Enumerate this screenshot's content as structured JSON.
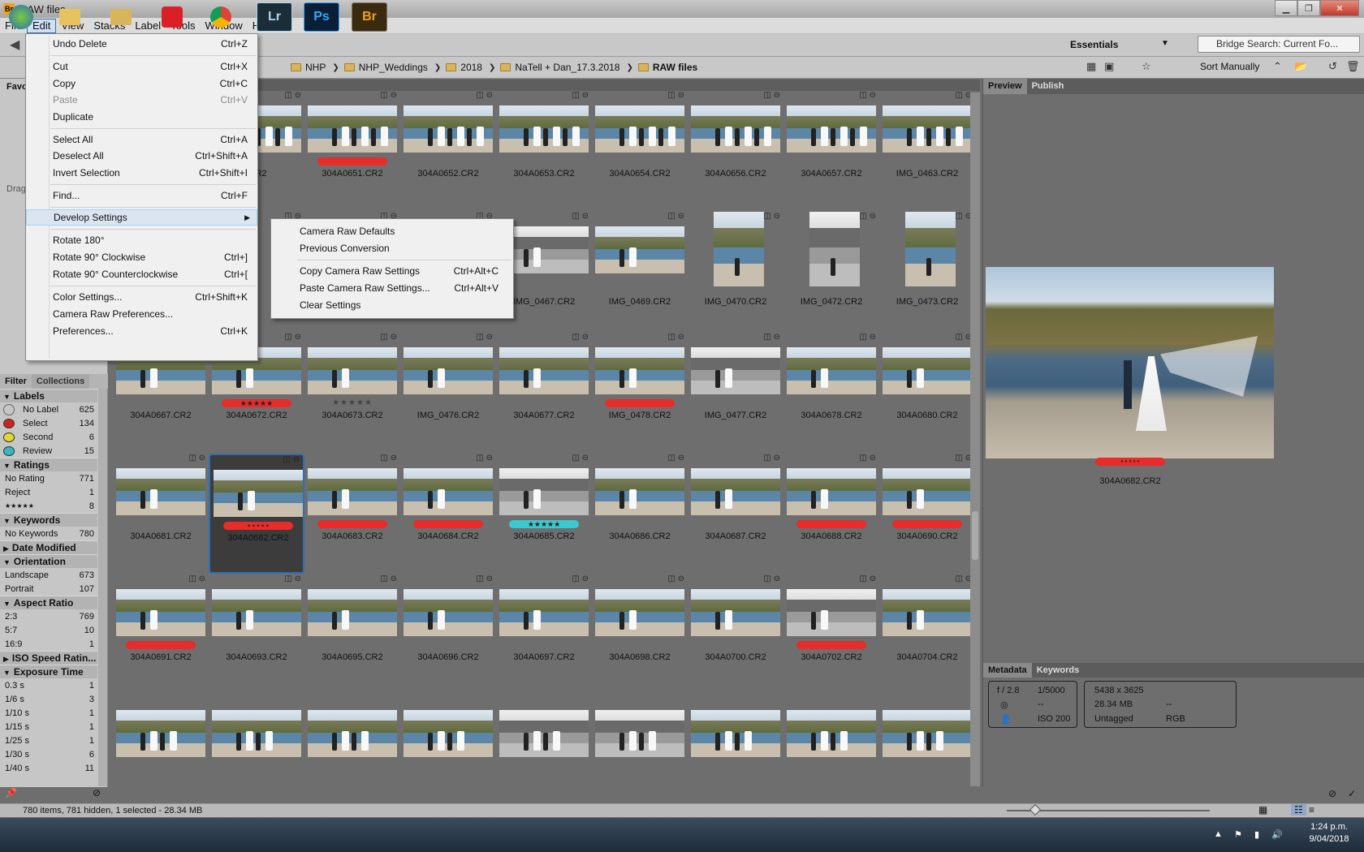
{
  "window": {
    "title": "RAW files"
  },
  "menubar": [
    "File",
    "Edit",
    "View",
    "Stacks",
    "Label",
    "Tools",
    "Window",
    "Help"
  ],
  "workspace": "Essentials",
  "search": {
    "placeholder": "Bridge Search: Current Fo..."
  },
  "breadcrumb": [
    "NHP",
    "NHP_Weddings",
    "2018",
    "NaTell + Dan_17.3.2018",
    "RAW files"
  ],
  "sort": "Sort Manually",
  "edit_menu": [
    {
      "label": "Undo Delete",
      "shortcut": "Ctrl+Z",
      "disabled": false
    },
    {
      "label": "Cut",
      "shortcut": "Ctrl+X",
      "disabled": false
    },
    {
      "label": "Copy",
      "shortcut": "Ctrl+C",
      "disabled": false
    },
    {
      "label": "Paste",
      "shortcut": "Ctrl+V",
      "disabled": true
    },
    {
      "label": "Duplicate",
      "shortcut": "",
      "disabled": false
    },
    {
      "label": "Select All",
      "shortcut": "Ctrl+A",
      "disabled": false
    },
    {
      "label": "Deselect All",
      "shortcut": "Ctrl+Shift+A",
      "disabled": false
    },
    {
      "label": "Invert Selection",
      "shortcut": "Ctrl+Shift+I",
      "disabled": false
    },
    {
      "label": "Find...",
      "shortcut": "Ctrl+F",
      "disabled": false
    },
    {
      "label": "Develop Settings",
      "shortcut": "",
      "disabled": false
    },
    {
      "label": "Rotate 180°",
      "shortcut": "",
      "disabled": false
    },
    {
      "label": "Rotate 90° Clockwise",
      "shortcut": "Ctrl+]",
      "disabled": false
    },
    {
      "label": "Rotate 90° Counterclockwise",
      "shortcut": "Ctrl+[",
      "disabled": false
    },
    {
      "label": "Color Settings...",
      "shortcut": "Ctrl+Shift+K",
      "disabled": false
    },
    {
      "label": "Camera Raw Preferences...",
      "shortcut": "",
      "disabled": false
    },
    {
      "label": "Preferences...",
      "shortcut": "Ctrl+K",
      "disabled": false
    }
  ],
  "develop_submenu": [
    {
      "label": "Camera Raw Defaults",
      "shortcut": ""
    },
    {
      "label": "Previous Conversion",
      "shortcut": ""
    },
    {
      "label": "Copy Camera Raw Settings",
      "shortcut": "Ctrl+Alt+C"
    },
    {
      "label": "Paste Camera Raw Settings...",
      "shortcut": "Ctrl+Alt+V"
    },
    {
      "label": "Clear Settings",
      "shortcut": ""
    }
  ],
  "left_panel": {
    "favorites_label": "Favo",
    "drag_label": "Drag",
    "tabs": [
      "Filter",
      "Collections"
    ],
    "sections": [
      {
        "title": "Labels",
        "rows": [
          [
            "No Label",
            "625"
          ],
          [
            "Select",
            "134"
          ],
          [
            "Second",
            "6"
          ],
          [
            "Review",
            "15"
          ]
        ]
      },
      {
        "title": "Ratings",
        "rows": [
          [
            "No Rating",
            "771"
          ],
          [
            "Reject",
            "1"
          ],
          [
            "★★★★★",
            "8"
          ]
        ]
      },
      {
        "title": "Keywords",
        "rows": [
          [
            "No Keywords",
            "780"
          ]
        ]
      },
      {
        "title": "Date Modified",
        "rows": []
      },
      {
        "title": "Orientation",
        "rows": [
          [
            "Landscape",
            "673"
          ],
          [
            "Portrait",
            "107"
          ]
        ]
      },
      {
        "title": "Aspect Ratio",
        "rows": [
          [
            "2:3",
            "769"
          ],
          [
            "5:7",
            "10"
          ],
          [
            "16:9",
            "1"
          ]
        ]
      },
      {
        "title": "ISO Speed Ratin...",
        "rows": []
      },
      {
        "title": "Exposure Time",
        "rows": [
          [
            "0.3 s",
            "1"
          ],
          [
            "1/6 s",
            "3"
          ],
          [
            "1/10 s",
            "1"
          ],
          [
            "1/15 s",
            "1"
          ],
          [
            "1/25 s",
            "1"
          ],
          [
            "1/30 s",
            "6"
          ],
          [
            "1/40 s",
            "11"
          ]
        ]
      }
    ]
  },
  "thumbnails": {
    "row1": [
      ".CR2",
      "304A0651.CR2",
      "304A0652.CR2",
      "304A0653.CR2",
      "304A0654.CR2",
      "304A0656.CR2",
      "304A0657.CR2",
      "IMG_0463.CR2"
    ],
    "row2": [
      "",
      "",
      "",
      "IMG_0467.CR2",
      "IMG_0469.CR2",
      "IMG_0470.CR2",
      "IMG_0472.CR2",
      "IMG_0473.CR2"
    ],
    "row3": [
      "304A0667.CR2",
      "304A0672.CR2",
      "304A0673.CR2",
      "IMG_0476.CR2",
      "304A0677.CR2",
      "IMG_0478.CR2",
      "IMG_0477.CR2",
      "304A0678.CR2",
      "304A0680.CR2"
    ],
    "row4": [
      "304A0681.CR2",
      "304A0682.CR2",
      "304A0683.CR2",
      "304A0684.CR2",
      "304A0685.CR2",
      "304A0686.CR2",
      "304A0687.CR2",
      "304A0688.CR2",
      "304A0690.CR2"
    ],
    "row5": [
      "304A0691.CR2",
      "304A0693.CR2",
      "304A0695.CR2",
      "304A0696.CR2",
      "304A0697.CR2",
      "304A0698.CR2",
      "304A0700.CR2",
      "304A0702.CR2",
      "304A0704.CR2"
    ],
    "stars_5": "★★★★★",
    "stars_dots": "• • • • •"
  },
  "preview": {
    "tabs": [
      "Preview",
      "Publish"
    ],
    "filename": "304A0682.CR2"
  },
  "metadata": {
    "tabs": [
      "Metadata",
      "Keywords"
    ],
    "aperture": "f / 2.8",
    "shutter": "1/5000",
    "metering": "--",
    "iso": "ISO 200",
    "dimensions": "5438 x 3625",
    "size": "28.34 MB",
    "dash": "--",
    "tagged": "Untagged",
    "color": "RGB"
  },
  "status": "780 items, 781 hidden, 1 selected - 28.34 MB",
  "taskbar": {
    "time": "1:24 p.m.",
    "date": "9/04/2018",
    "apps": [
      "Lr",
      "Ps",
      "Br"
    ]
  },
  "colors": {
    "red_label": "#e82b2b",
    "teal_label": "#3cc8cf",
    "selection": "#2f6fb5"
  }
}
